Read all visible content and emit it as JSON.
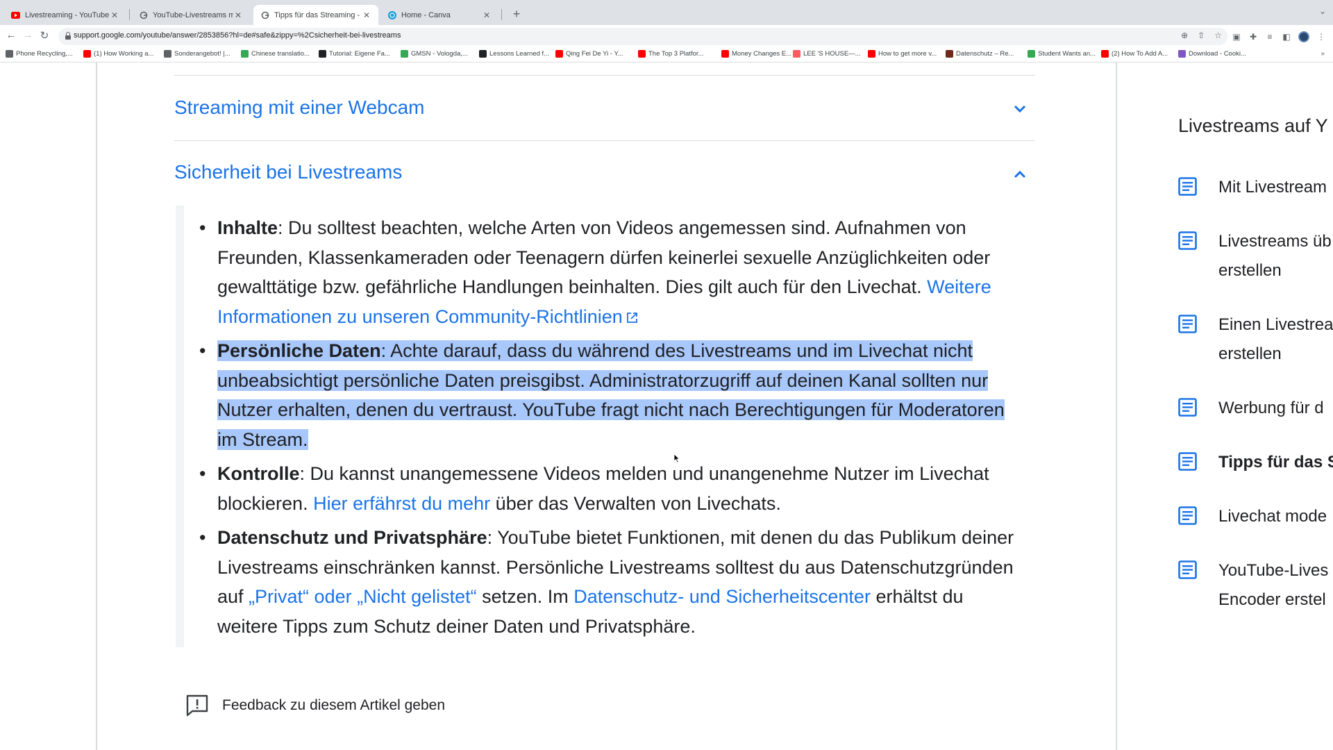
{
  "browser": {
    "tabs": [
      {
        "title": "Livestreaming - YouTube Studio",
        "favicon": "youtube-icon",
        "active": false
      },
      {
        "title": "YouTube-Livestreams mit einem...",
        "favicon": "google-icon",
        "active": false
      },
      {
        "title": "Tipps für das Streaming - YouTube",
        "favicon": "google-icon",
        "active": true
      },
      {
        "title": "Home - Canva",
        "favicon": "canva-icon",
        "active": false
      }
    ],
    "url": "support.google.com/youtube/answer/2853856?hl=de#safe&zippy=%2Csicherheit-bei-livestreams",
    "bookmarks": [
      {
        "label": "Phone Recycling,...",
        "icon": "ogoogle-icon",
        "color": "#5f6368"
      },
      {
        "label": "(1) How Working a...",
        "icon": "youtube-icon",
        "color": "#ff0000"
      },
      {
        "label": "Sonderangebot! |...",
        "icon": "sonder-icon",
        "color": "#5f6368"
      },
      {
        "label": "Chinese translatio...",
        "icon": "translate-icon",
        "color": "#34a853"
      },
      {
        "label": "Tutorial: Eigene Fa...",
        "icon": "hash-icon",
        "color": "#202124"
      },
      {
        "label": "GMSN - Vologda,...",
        "icon": "gmsn-icon",
        "color": "#34a853"
      },
      {
        "label": "Lessons Learned f...",
        "icon": "blog-icon",
        "color": "#202124"
      },
      {
        "label": "Qing Fei De Yi - Y...",
        "icon": "youtube-icon",
        "color": "#ff0000"
      },
      {
        "label": "The Top 3 Platfor...",
        "icon": "youtube-icon",
        "color": "#ff0000"
      },
      {
        "label": "Money Changes E...",
        "icon": "youtube-icon",
        "color": "#ff0000"
      },
      {
        "label": "LEE 'S HOUSE—...",
        "icon": "airbnb-icon",
        "color": "#ff5a5f"
      },
      {
        "label": "How to get more v...",
        "icon": "youtube-icon",
        "color": "#ff0000"
      },
      {
        "label": "Datenschutz – Re...",
        "icon": "datenschutz-icon",
        "color": "#6d2a1a"
      },
      {
        "label": "Student Wants an...",
        "icon": "student-icon",
        "color": "#34a853"
      },
      {
        "label": "(2) How To Add A...",
        "icon": "youtube-icon",
        "color": "#ff0000"
      },
      {
        "label": "Download - Cooki...",
        "icon": "cookie-icon",
        "color": "#7e57c2"
      }
    ]
  },
  "article": {
    "section_webcam": "Streaming mit einer Webcam",
    "section_safety": "Sicherheit bei Livestreams",
    "items": [
      {
        "label": "Inhalte",
        "text": ": Du solltest beachten, welche Arten von Videos angemessen sind. Aufnahmen von Freunden, Klassenkameraden oder Teenagern dürfen keinerlei sexuelle Anzüglichkeiten oder gewalttätige bzw. gefährliche Handlungen beinhalten. Dies gilt auch für den Livechat. ",
        "link": "Weitere Informationen zu unseren Community-Richtlinien"
      },
      {
        "label": "Persönliche Daten",
        "text": ": Achte darauf, dass du während des Livestreams und im Livechat nicht unbeabsichtigt persönliche Daten preisgibst. Administratorzugriff auf deinen Kanal sollten nur Nutzer erhalten, denen du vertraust. YouTube fragt nicht nach Berechtigungen für Moderatoren im Stream."
      },
      {
        "label": "Kontrolle",
        "text_before": ": Du kannst unangemessene Videos melden und unangenehme Nutzer im Livechat blockieren. ",
        "link": "Hier erfährst du mehr",
        "text_after": " über das Verwalten von Livechats."
      },
      {
        "label": "Datenschutz und Privatsphäre",
        "text_before": ": YouTube bietet Funktionen, mit denen du das Publikum deiner Livestreams einschränken kannst. Persönliche Livestreams solltest du aus Datenschutzgründen auf ",
        "link1": "„Privat“ oder „Nicht gelistet“",
        "text_middle": " setzen. Im ",
        "link2": "Datenschutz- und Sicherheitscenter",
        "text_after": " erhältst du weitere Tipps zum Schutz deiner Daten und Privatsphäre."
      }
    ],
    "feedback": "Feedback zu diesem Artikel geben"
  },
  "sidebar": {
    "title": "Livestreams auf Y",
    "items": [
      {
        "line1": "Mit Livestream",
        "line2": ""
      },
      {
        "line1": "Livestreams üb",
        "line2": "erstellen"
      },
      {
        "line1": "Einen Livestrea",
        "line2": "erstellen"
      },
      {
        "line1": "Werbung für d",
        "line2": ""
      },
      {
        "line1": "Tipps für das S",
        "line2": "",
        "active": true
      },
      {
        "line1": "Livechat mode",
        "line2": ""
      },
      {
        "line1": "YouTube-Lives",
        "line2": "Encoder erstel"
      }
    ]
  },
  "colors": {
    "link": "#1a73e8",
    "highlight": "#a8c7fa",
    "text": "#202124"
  }
}
